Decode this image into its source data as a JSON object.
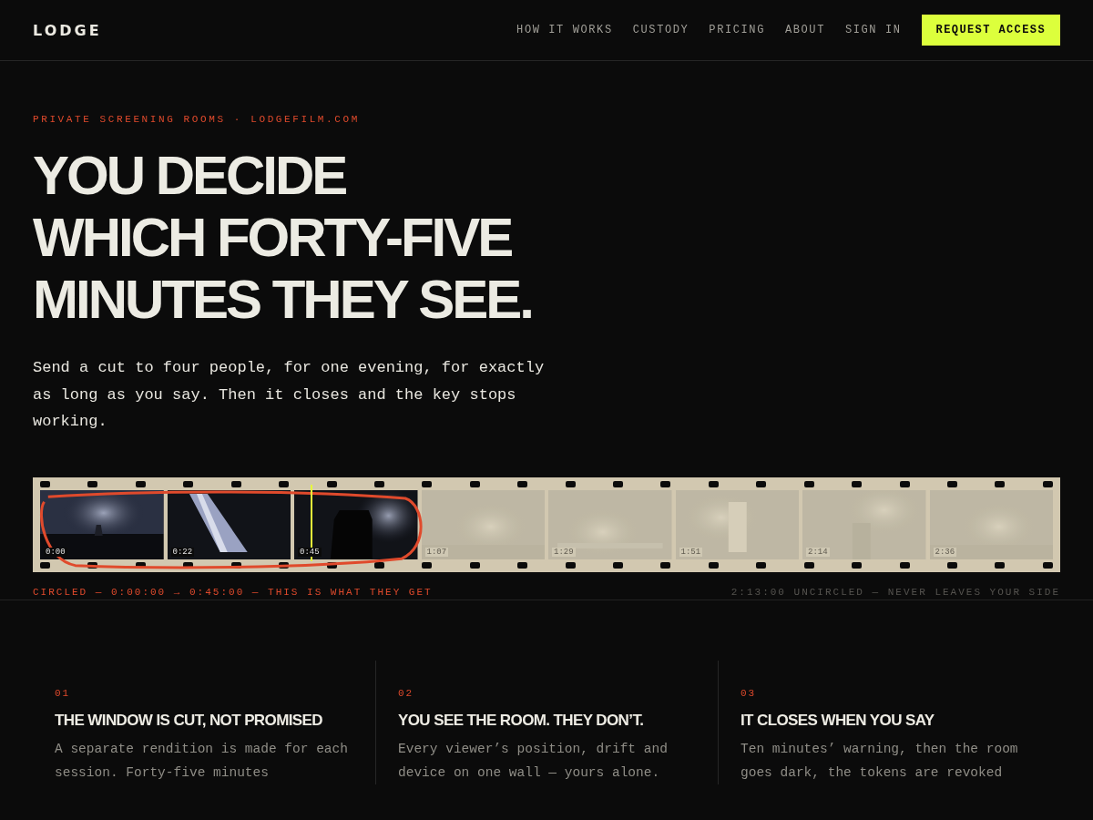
{
  "brand": "LODGE",
  "nav": {
    "links": [
      "HOW IT WORKS",
      "CUSTODY",
      "PRICING",
      "ABOUT",
      "SIGN IN"
    ],
    "cta": "REQUEST ACCESS"
  },
  "hero": {
    "eyebrow": "PRIVATE SCREENING ROOMS · LODGEFILM.COM",
    "headline": [
      "YOU DECIDE",
      "WHICH FORTY-FIVE",
      "MINUTES THEY SEE."
    ],
    "lede": "Send a cut to four people, for one evening, for exactly as long as you say. Then it closes and the key stops working."
  },
  "filmstrip": {
    "playhead": {
      "level": 0.27
    },
    "frames": [
      {
        "time": "0:00",
        "circled": true,
        "kind": "picture"
      },
      {
        "time": "0:22",
        "circled": true,
        "kind": "picture"
      },
      {
        "time": "0:45",
        "circled": true,
        "kind": "picture"
      },
      {
        "time": "1:07",
        "circled": false,
        "kind": "picture"
      },
      {
        "time": "1:29",
        "circled": false,
        "kind": "picture"
      },
      {
        "time": "1:51",
        "circled": false,
        "kind": "picture"
      },
      {
        "time": "2:14",
        "circled": false,
        "kind": "picture"
      },
      {
        "time": "2:36",
        "circled": false,
        "kind": "picture"
      }
    ],
    "caption_left": "CIRCLED — 0:00:00 → 0:45:00 — THIS IS WHAT THEY GET",
    "caption_right": "2:13:00 UNCIRCLED — NEVER LEAVES YOUR SIDE"
  },
  "features": [
    {
      "number": "01",
      "title": "THE WINDOW IS CUT, NOT PROMISED",
      "text": "A separate rendition is made for each session. Forty-five minutes"
    },
    {
      "number": "02",
      "title": "YOU SEE THE ROOM. THEY DON’T.",
      "text": "Every viewer’s position, drift and device on one wall — yours alone."
    },
    {
      "number": "03",
      "title": "IT CLOSES WHEN YOU SAY",
      "text": "Ten minutes’ warning, then the room goes dark, the tokens are revoked"
    }
  ]
}
